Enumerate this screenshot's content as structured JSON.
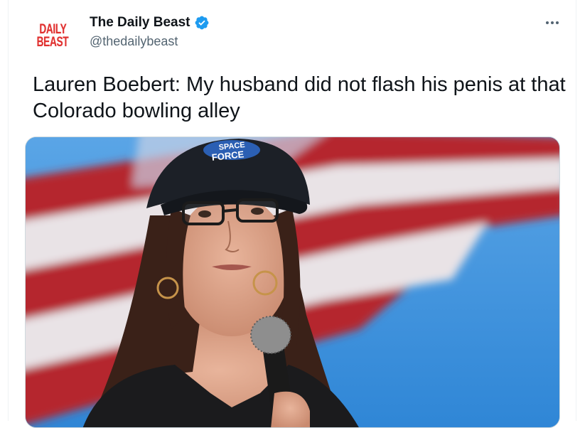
{
  "tweet": {
    "author": {
      "avatar_logo": [
        "DAILY",
        "BEAST"
      ],
      "display_name": "The Daily Beast",
      "handle": "@thedailybeast",
      "verified": true
    },
    "text": "Lauren Boebert: My husband did not flash his penis at that Colorado bowling alley",
    "more_icon": "more-horizontal-icon",
    "media": {
      "kind": "photo",
      "cap_text": [
        "SPACE",
        "FORCE"
      ]
    }
  },
  "colors": {
    "logo_red": "#e0302f",
    "verified_blue": "#1d9bf0",
    "secondary_text": "#536471",
    "sky_blue": "#3f93dd",
    "flag_red": "#b5262f"
  }
}
